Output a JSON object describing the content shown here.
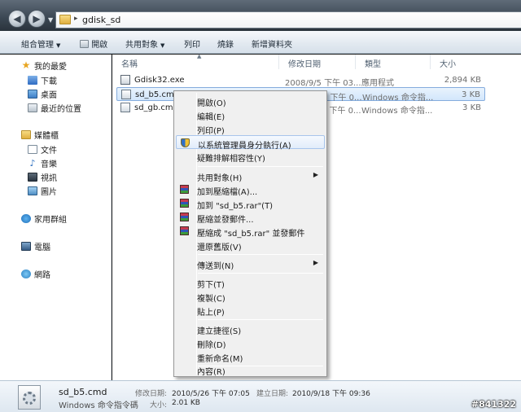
{
  "address": {
    "path": "gdisk_sd",
    "separator": "▸"
  },
  "commandbar": {
    "organize": "組合管理",
    "open": "開啟",
    "share": "共用對象",
    "print": "列印",
    "burn": "燒錄",
    "new_folder": "新增資料夾"
  },
  "sidebar": {
    "favorites": "我的最愛",
    "favorites_items": [
      "下載",
      "桌面",
      "最近的位置"
    ],
    "libraries": "媒體櫃",
    "libraries_items": [
      "文件",
      "音樂",
      "視訊",
      "圖片"
    ],
    "homegroup": "家用群組",
    "computer": "電腦",
    "network": "網路"
  },
  "file_list": {
    "columns": [
      "名稱",
      "修改日期",
      "類型",
      "大小"
    ],
    "rows": [
      {
        "name": "Gdisk32.exe",
        "date": "2008/9/5 下午 03...",
        "type": "應用程式",
        "size": "2,894 KB",
        "icon": "exe-icon"
      },
      {
        "name": "sd_b5.cmd",
        "date": "2010/5/26 下午 0...",
        "type": "Windows 命令指...",
        "size": "3 KB",
        "icon": "cmd-icon",
        "selected": true
      },
      {
        "name": "sd_gb.cmd",
        "date": "2010/5/26 下午 0...",
        "type": "Windows 命令指...",
        "size": "3 KB",
        "icon": "cmd-icon"
      }
    ]
  },
  "context_menu": {
    "items": [
      "開啟(O)",
      "編輯(E)",
      "列印(P)",
      "以系統管理員身分執行(A)",
      "疑難排解相容性(Y)",
      "共用對象(H)",
      "加到壓縮檔(A)...",
      "加到 \"sd_b5.rar\"(T)",
      "壓縮並發郵件...",
      "壓縮成 \"sd_b5.rar\" 並發郵件",
      "還原舊版(V)",
      "傳送到(N)",
      "剪下(T)",
      "複製(C)",
      "貼上(P)",
      "建立捷徑(S)",
      "刪除(D)",
      "重新命名(M)",
      "內容(R)"
    ],
    "highlighted": "以系統管理員身分執行(A)"
  },
  "details": {
    "name": "sd_b5.cmd",
    "type": "Windows 命令指令碼",
    "modified_label": "修改日期:",
    "modified_value": "2010/5/26 下午 07:05",
    "created_label": "建立日期:",
    "created_value": "2010/9/18 下午 09:36",
    "size_label": "大小:",
    "size_value": "2.01 KB"
  },
  "watermark": "#841322",
  "colors": {
    "selection_bg": "#d2e6fb",
    "selection_border": "#84acdd",
    "menu_bg": "#f0f0f0",
    "titlebar_dark": "#2a333c"
  }
}
